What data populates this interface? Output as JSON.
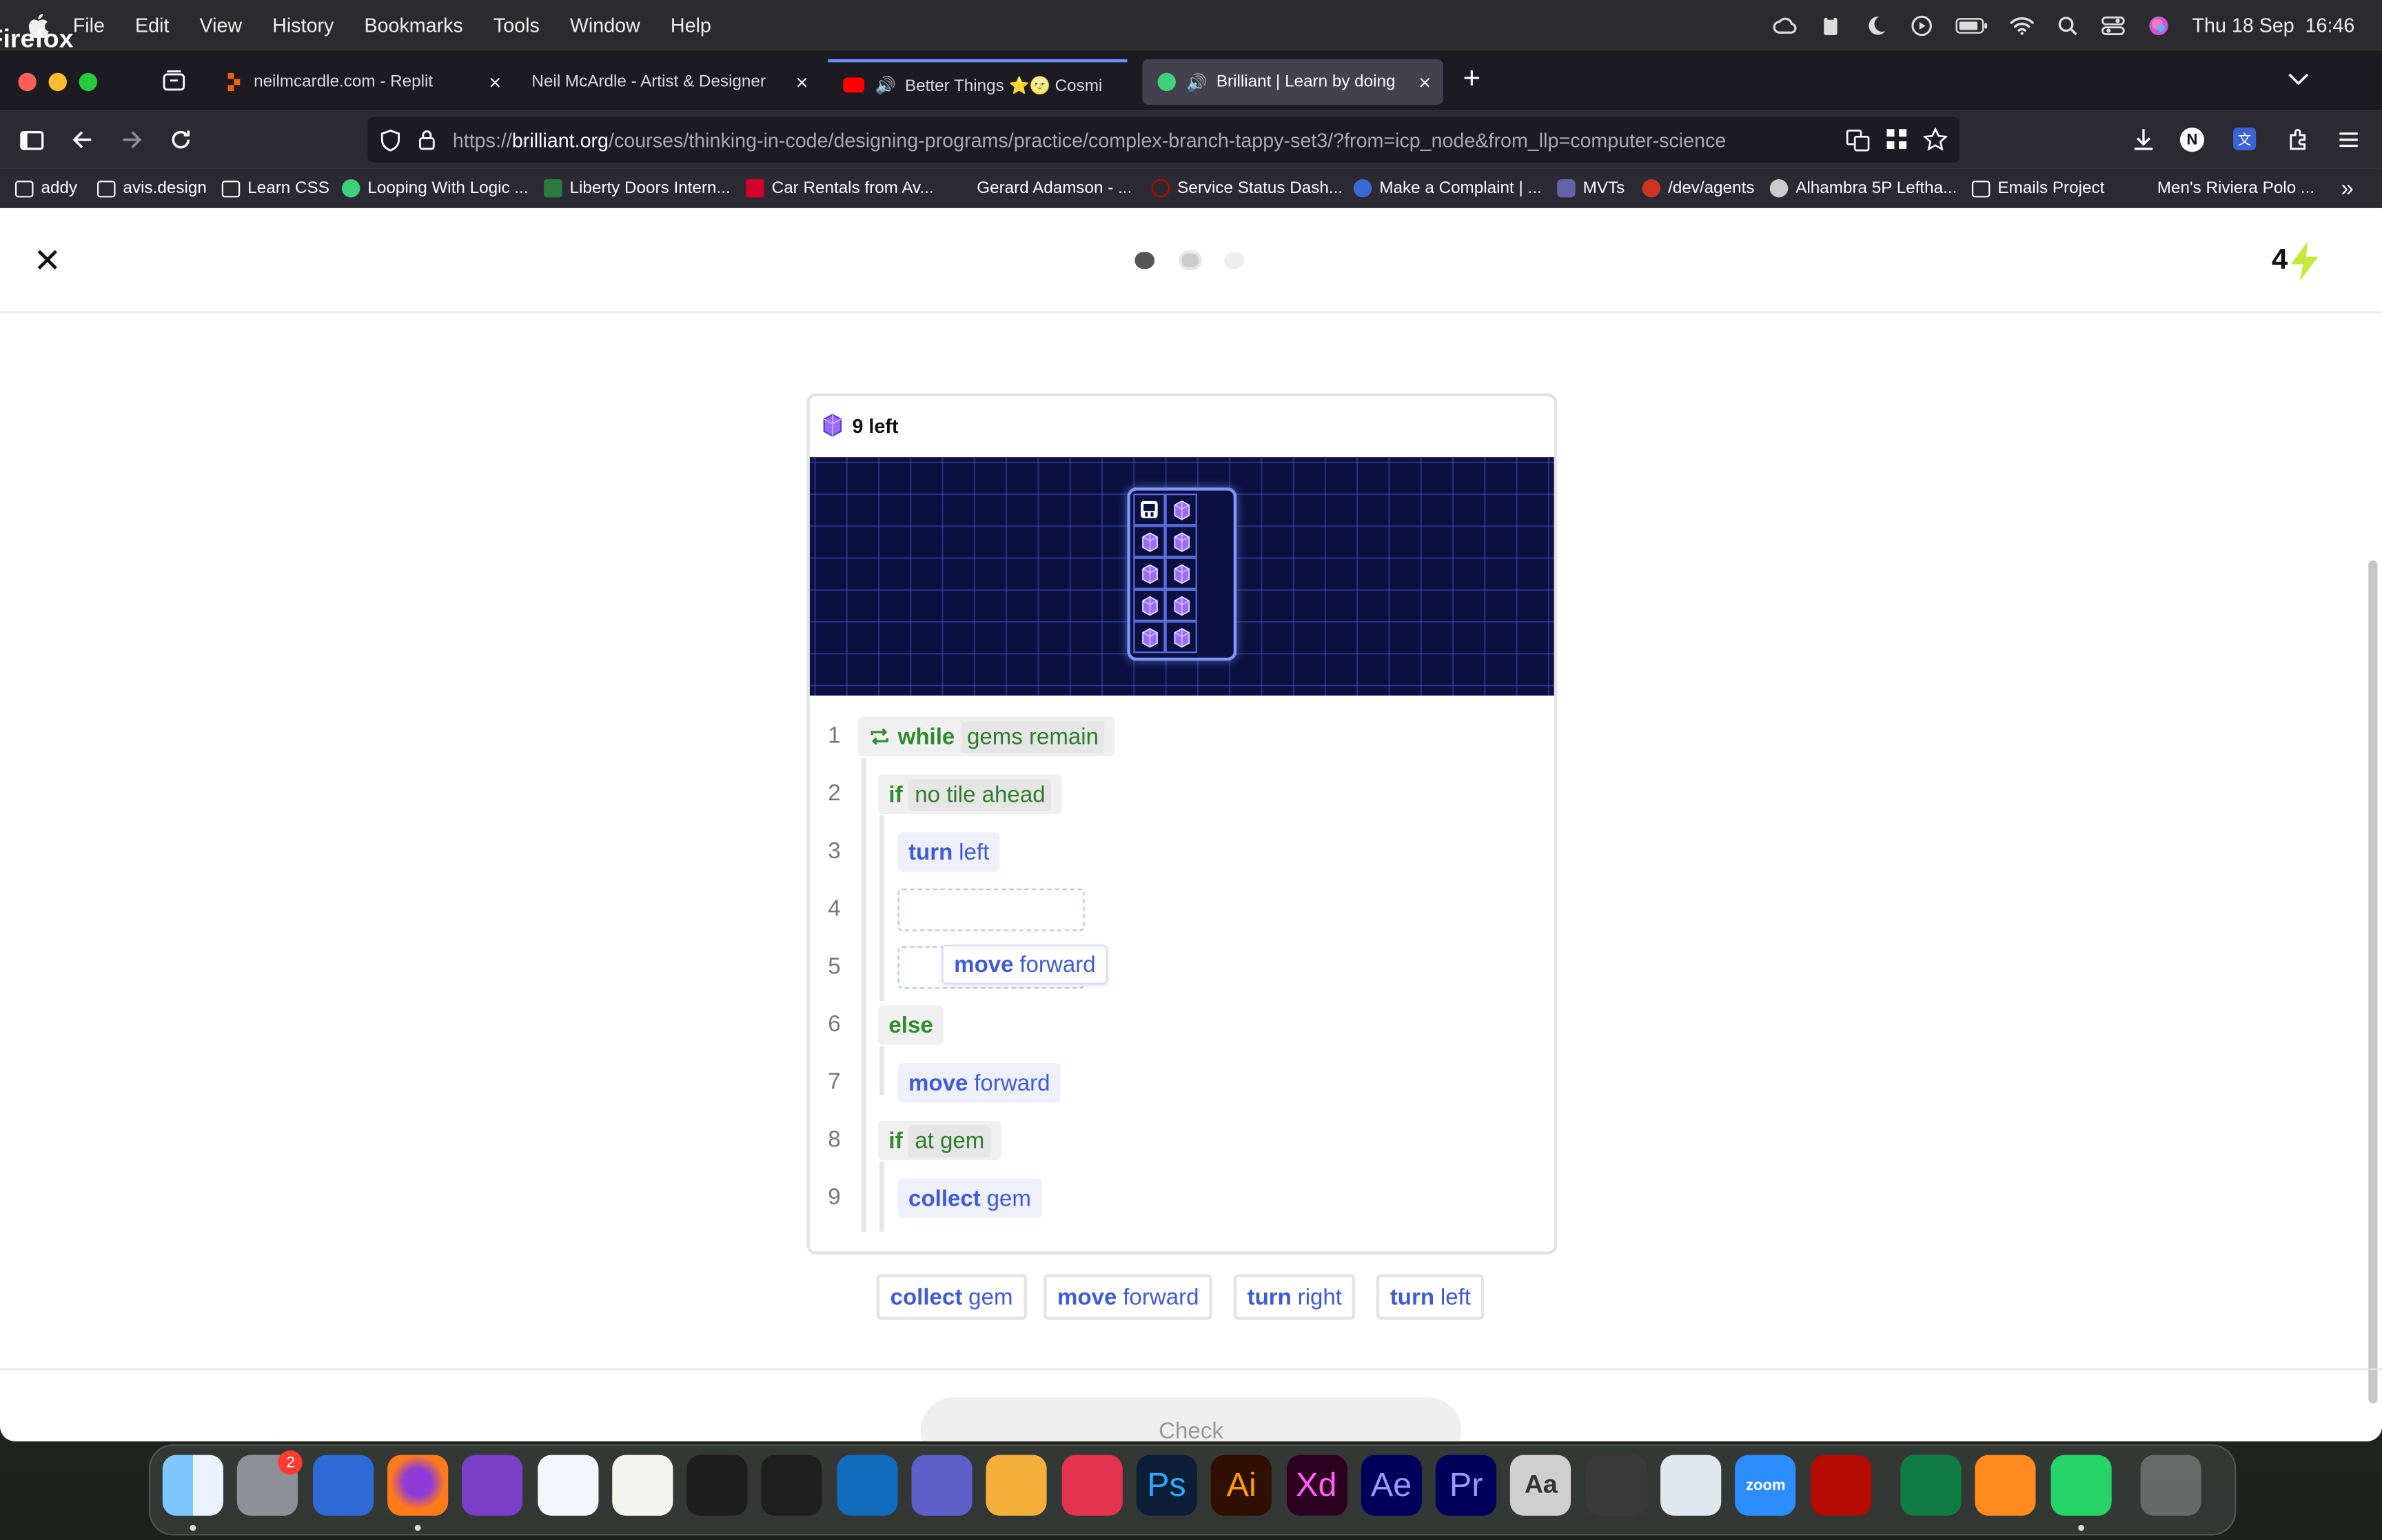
{
  "menubar": {
    "app": "Firefox",
    "items": [
      "File",
      "Edit",
      "View",
      "History",
      "Bookmarks",
      "Tools",
      "Window",
      "Help"
    ],
    "clock": "Thu 18 Sep  16:46"
  },
  "tabs": [
    {
      "title": "neilmcardle.com - Replit",
      "favicon_color": "#f26207",
      "active": false
    },
    {
      "title": "Neil McArdle - Artist & Designer",
      "favicon_color": "",
      "active": false
    },
    {
      "title": "Better Things ⭐🌝 Cosmic",
      "favicon_color": "#ff0000",
      "active": false
    },
    {
      "title": "Brilliant | Learn by doing",
      "favicon_color": "#3dd17a",
      "active": true
    }
  ],
  "url": {
    "scheme": "https://",
    "domain": "brilliant.org",
    "path": "/courses/thinking-in-code/designing-programs/practice/complex-branch-tappy-set3/?from=icp_node&from_llp=computer-science"
  },
  "bookmarks": [
    {
      "label": "addy",
      "icon": "folder"
    },
    {
      "label": "avis.design",
      "icon": "folder"
    },
    {
      "label": "Learn CSS",
      "icon": "folder"
    },
    {
      "label": "Looping With Logic ...",
      "icon": "#3dd17a"
    },
    {
      "label": "Liberty Doors Intern...",
      "icon": "#2c7a3c"
    },
    {
      "label": "Car Rentals from Av...",
      "icon": "#d4002a"
    },
    {
      "label": "Gerard Adamson - ...",
      "icon": "none"
    },
    {
      "label": "Service Status Dash...",
      "icon": "#cc0000"
    },
    {
      "label": "Make a Complaint | ...",
      "icon": "#3a6ad1"
    },
    {
      "label": "MVTs",
      "icon": "#6264a7"
    },
    {
      "label": "/dev/agents",
      "icon": "#cc3322"
    },
    {
      "label": "Alhambra 5P Leftha...",
      "icon": "#cccccc"
    },
    {
      "label": "Emails Project",
      "icon": "folder"
    },
    {
      "label": "Men's Riviera Polo ...",
      "icon": "none"
    }
  ],
  "lesson": {
    "progress_dots": 3,
    "current_dot": 1,
    "score": "4",
    "gems_left": "9 left",
    "gem_grid": {
      "rows": 5,
      "cols": 2,
      "robot_cell": [
        0,
        0
      ]
    },
    "code_lines": [
      {
        "n": "1",
        "type": "ctl",
        "kw": "while",
        "arg": "gems remain",
        "icon": "loop-icon"
      },
      {
        "n": "2",
        "type": "ctl",
        "kw": "if",
        "arg": "no tile ahead"
      },
      {
        "n": "3",
        "type": "act",
        "kw": "turn",
        "arg": "left"
      },
      {
        "n": "4",
        "type": "slot"
      },
      {
        "n": "5",
        "type": "drag",
        "kw": "move",
        "arg": "forward"
      },
      {
        "n": "6",
        "type": "ctl",
        "kw": "else",
        "arg": ""
      },
      {
        "n": "7",
        "type": "act",
        "kw": "move",
        "arg": "forward"
      },
      {
        "n": "8",
        "type": "ctl",
        "kw": "if",
        "arg": "at gem"
      },
      {
        "n": "9",
        "type": "act",
        "kw": "collect",
        "arg": "gem"
      }
    ],
    "palette": [
      {
        "kw": "collect",
        "arg": "gem"
      },
      {
        "kw": "move",
        "arg": "forward"
      },
      {
        "kw": "turn",
        "arg": "right"
      },
      {
        "kw": "turn",
        "arg": "left"
      }
    ],
    "check_label": "Check"
  },
  "dock": {
    "system_prefs_badge": "2",
    "apps": [
      "Finder",
      "System Settings",
      "Launchpad",
      "Firefox",
      "GitHub Desktop",
      "Visual Studio Code",
      "TextEdit",
      "Terminal",
      "Figma",
      "Outlook",
      "Teams",
      "Chrome Canary",
      "Creative Cloud",
      "Photoshop",
      "Illustrator",
      "Adobe XD",
      "After Effects",
      "Premiere Pro",
      "Font Book",
      "Calculator",
      "Preview",
      "Zoom",
      "Acrobat",
      "Excel",
      "Books",
      "WhatsApp",
      "Trash"
    ],
    "labels": {
      "ps": "Ps",
      "ai": "Ai",
      "xd": "Xd",
      "ae": "Ae",
      "pr": "Pr",
      "zoom": "zoom",
      "fontbook": "A A\nA a"
    }
  }
}
